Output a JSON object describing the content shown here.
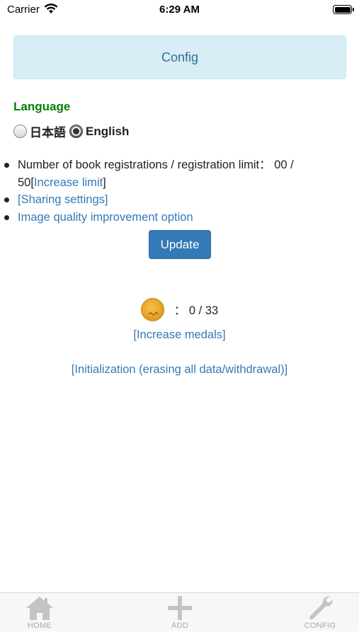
{
  "status_bar": {
    "carrier": "Carrier",
    "time": "6:29 AM"
  },
  "header": {
    "title": "Config"
  },
  "language": {
    "title": "Language",
    "options": [
      {
        "label": "日本語",
        "selected": false
      },
      {
        "label": "English",
        "selected": true
      }
    ]
  },
  "info": {
    "registrations_text": "Number of book registrations / registration limit： 00 / 50",
    "increase_limit_open": "[",
    "increase_limit_label": "Increase limit",
    "increase_limit_close": "]",
    "sharing_settings": "[Sharing settings]",
    "image_quality": "Image quality improvement option"
  },
  "update_button": "Update",
  "medals": {
    "count_text": "： 0 / 33",
    "increase_label": "[Increase medals]",
    "icon": "medal-icon"
  },
  "initialization_label": "[Initialization (erasing all data/withdrawal)]",
  "tabs": [
    {
      "label": "HOME",
      "icon": "home-icon"
    },
    {
      "label": "ADD",
      "icon": "plus-icon"
    },
    {
      "label": "CONFIG",
      "icon": "wrench-icon"
    }
  ],
  "colors": {
    "link": "#337ab7",
    "accent_green": "#008000",
    "header_bg": "#d9edf7",
    "button_bg": "#337ab7"
  }
}
